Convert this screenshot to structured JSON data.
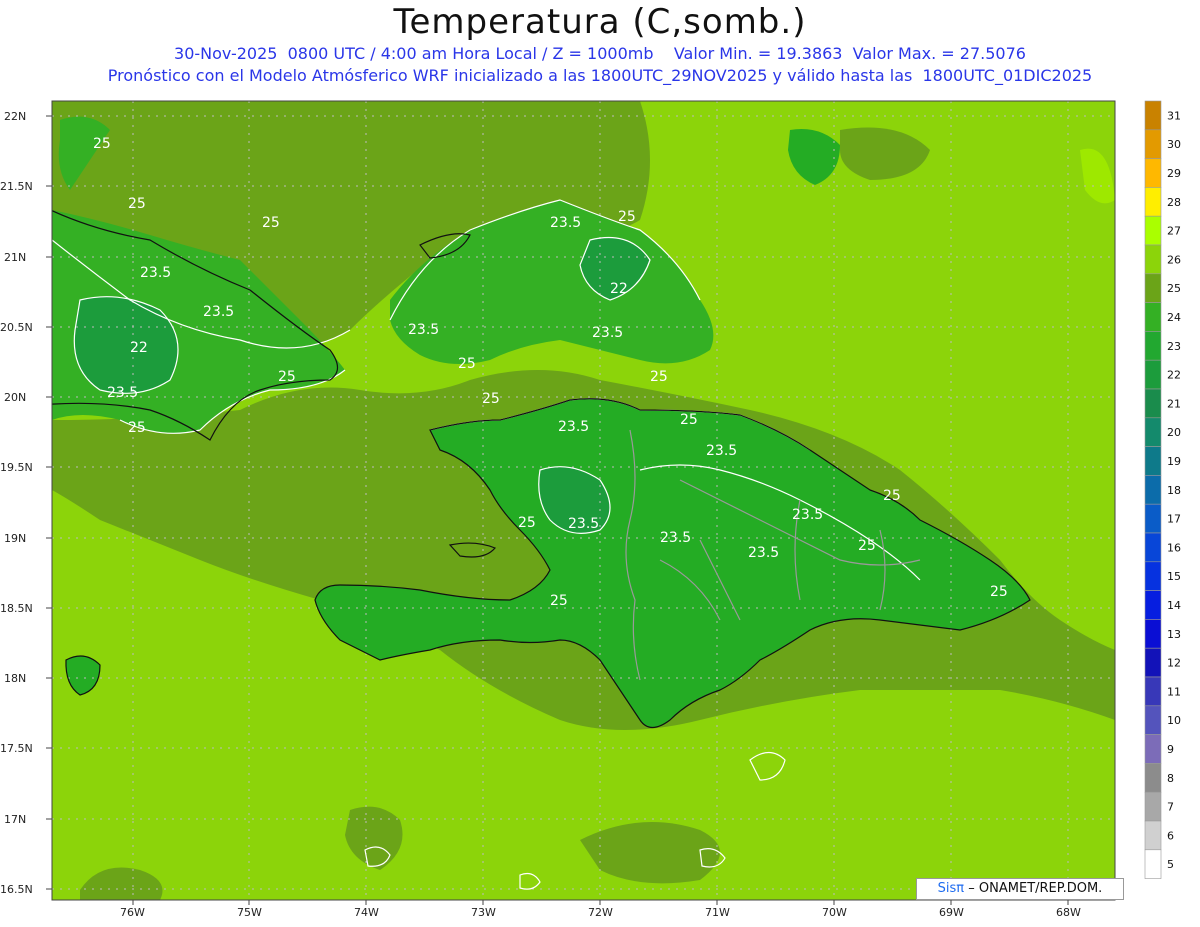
{
  "title": "Temperatura (C,somb.)",
  "subtitle_1": "30-Nov-2025  0800 UTC / 4:00 am Hora Local / Z = 1000mb    Valor Min. = 19.3863  Valor Max. = 27.5076",
  "subtitle_2": "Pronóstico con el Modelo Atmósferico WRF inicializado a las 1800UTC_29NOV2025 y válido hasta las  1800UTC_01DIC2025",
  "credit": {
    "brand": "Sisπ",
    "text": "– ONAMET/REP.DOM."
  },
  "colors": {
    "text": "#2a36e8",
    "ocean_base": "#8cd40a",
    "land_base": "#24ac24"
  },
  "lat_labels": [
    "22N",
    "21.5N",
    "21N",
    "20.5N",
    "20N",
    "19.5N",
    "19N",
    "18.5N",
    "18N",
    "17.5N",
    "17N",
    "16.5N"
  ],
  "lon_labels": [
    "76W",
    "75W",
    "74W",
    "73W",
    "72W",
    "71W",
    "70W",
    "69W",
    "68W"
  ],
  "contour_labels": [
    "25",
    "25",
    "25",
    "23.5",
    "23.5",
    "22",
    "23.5",
    "25",
    "25",
    "23.5",
    "25",
    "22",
    "23.5",
    "23.5",
    "25",
    "25",
    "25",
    "25",
    "23.5",
    "23.5",
    "25",
    "23.5",
    "23.5",
    "25",
    "23.5",
    "23.5",
    "25",
    "25",
    "25"
  ],
  "colorbar": [
    {
      "label": "31",
      "color": "#c98200"
    },
    {
      "label": "30",
      "color": "#e39a00"
    },
    {
      "label": "29",
      "color": "#ffb800"
    },
    {
      "label": "28",
      "color": "#ffee00"
    },
    {
      "label": "27",
      "color": "#aaff00"
    },
    {
      "label": "26",
      "color": "#8cd40a"
    },
    {
      "label": "25",
      "color": "#6ba418"
    },
    {
      "label": "24",
      "color": "#34b024"
    },
    {
      "label": "23",
      "color": "#22a830"
    },
    {
      "label": "22",
      "color": "#1c9c3c"
    },
    {
      "label": "21",
      "color": "#1a8c4c"
    },
    {
      "label": "20",
      "color": "#148a6c"
    },
    {
      "label": "19",
      "color": "#0e7a8a"
    },
    {
      "label": "18",
      "color": "#0c6caa"
    },
    {
      "label": "17",
      "color": "#0a5cc8"
    },
    {
      "label": "16",
      "color": "#0846d8"
    },
    {
      "label": "15",
      "color": "#0632e0"
    },
    {
      "label": "14",
      "color": "#061ee0"
    },
    {
      "label": "13",
      "color": "#0a0ed4"
    },
    {
      "label": "12",
      "color": "#1212b8"
    },
    {
      "label": "11",
      "color": "#3838b8"
    },
    {
      "label": "10",
      "color": "#5454bc"
    },
    {
      "label": "9",
      "color": "#7c6cb8"
    },
    {
      "label": "8",
      "color": "#8c8c8c"
    },
    {
      "label": "7",
      "color": "#a8a8a8"
    },
    {
      "label": "6",
      "color": "#d0d0d0"
    },
    {
      "label": "5",
      "color": "#ffffff"
    }
  ]
}
